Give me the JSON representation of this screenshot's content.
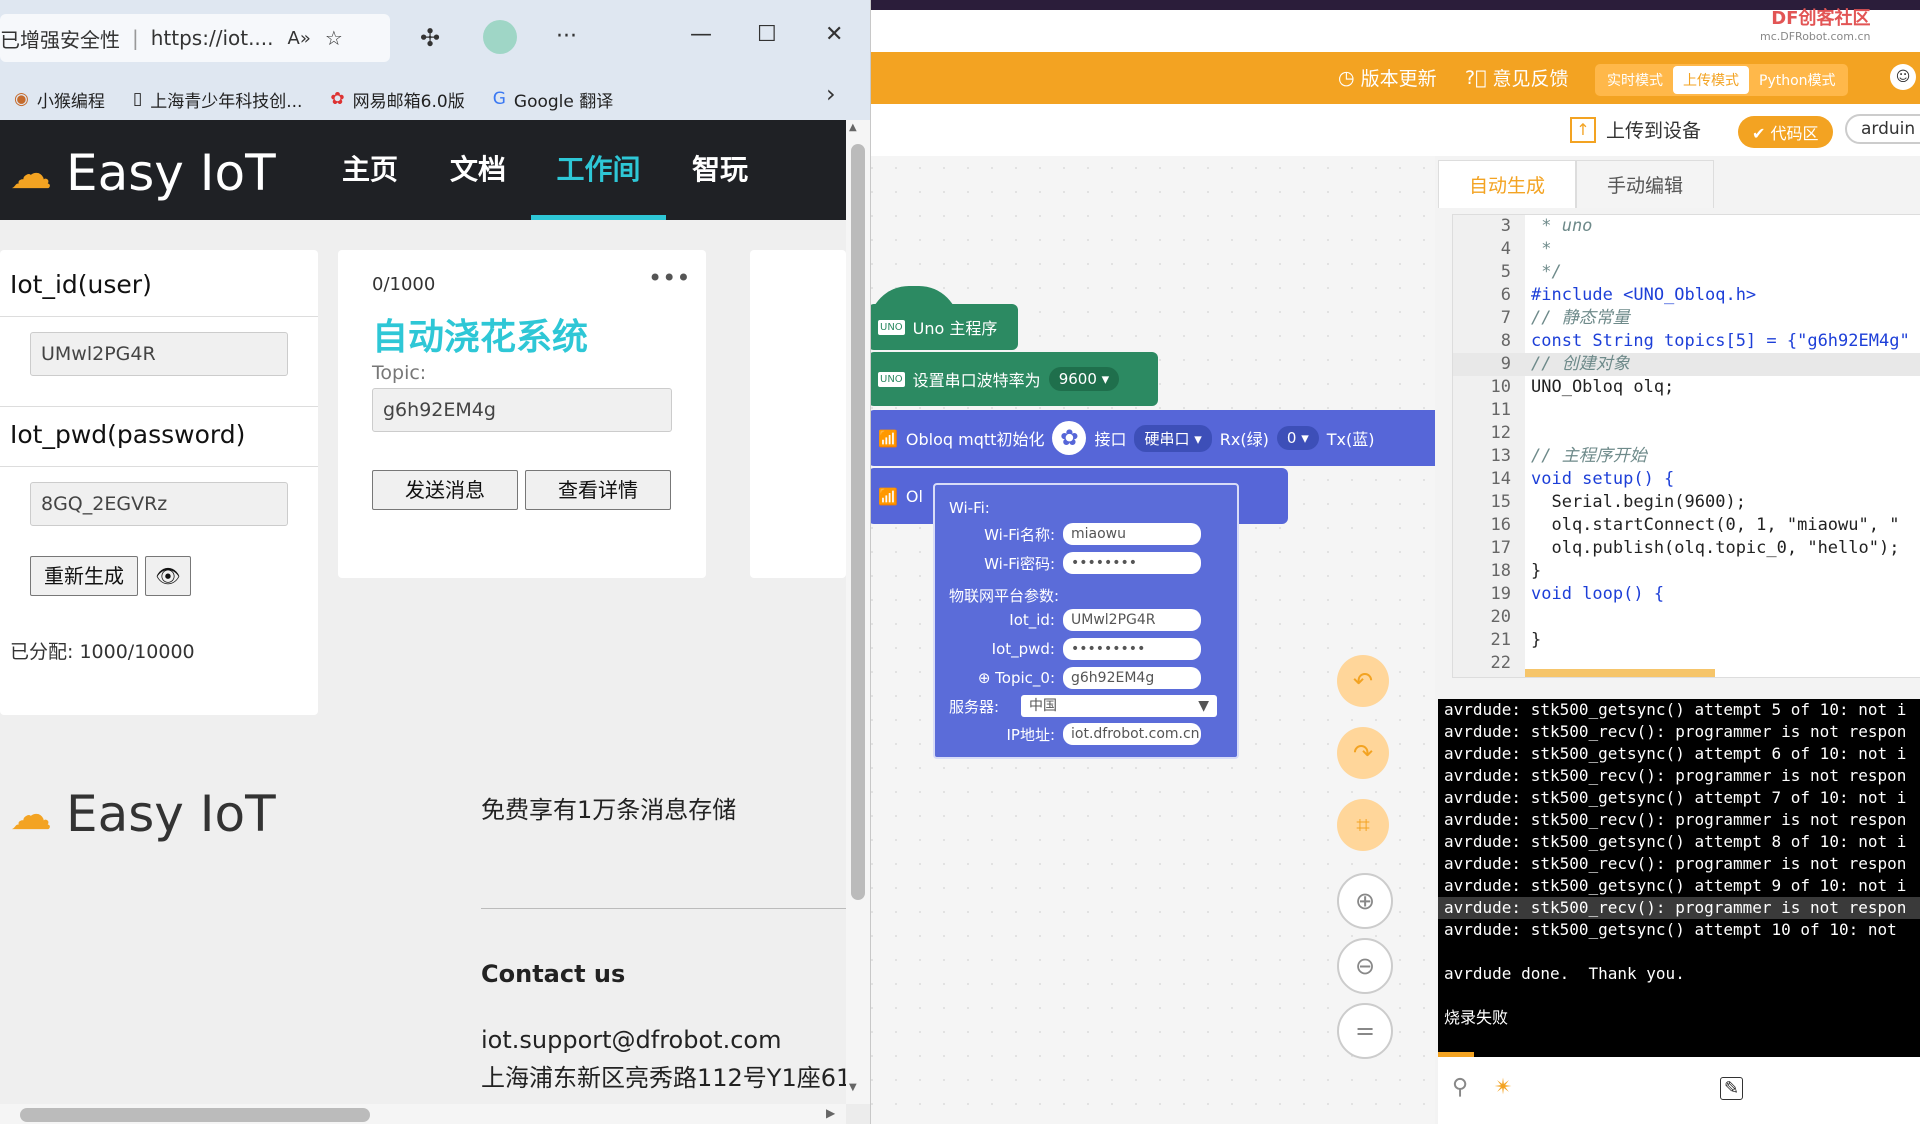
{
  "ide": {
    "watermark": {
      "brand": "DF创客社区",
      "url": "mc.DFRobot.com.cn"
    },
    "header": {
      "version_update": "版本更新",
      "feedback": "意见反馈",
      "modes": [
        "实时模式",
        "上传模式",
        "Python模式"
      ],
      "active_mode": "上传模式"
    },
    "toolbar": {
      "upload": "上传到设备",
      "code_area": "代码区",
      "lang": "arduin"
    },
    "blocks": {
      "main": "Uno 主程序",
      "serial_label": "设置串口波特率为",
      "baud": "9600",
      "mqtt_init": "Obloq mqtt初始化",
      "port_label": "接口",
      "port_value": "硬串口",
      "rx_label": "Rx(绿)",
      "rx_value": "0",
      "tx_label": "Tx(蓝)",
      "second_prefix": "Ol"
    },
    "popup": {
      "wifi_header": "Wi-Fi:",
      "wifi_name_label": "Wi-Fi名称:",
      "wifi_name": "miaowu",
      "wifi_pwd_label": "Wi-Fi密码:",
      "wifi_pwd": "••••••••",
      "iot_header": "物联网平台参数:",
      "iot_id_label": "Iot_id:",
      "iot_id": "UMwl2PG4R",
      "iot_pwd_label": "Iot_pwd:",
      "iot_pwd": "•••••••••",
      "topic_label": "Topic_0:",
      "topic": "g6h92EM4g",
      "server_label": "服务器:",
      "server": "中国",
      "ip_label": "IP地址:",
      "ip": "iot.dfrobot.com.cn"
    },
    "tabs": {
      "auto": "自动生成",
      "manual": "手动编辑"
    },
    "code_lines": [
      {
        "n": "3",
        "t": " * uno"
      },
      {
        "n": "4",
        "t": " *"
      },
      {
        "n": "5",
        "t": " */"
      },
      {
        "n": "6",
        "t": "#include <UNO_Obloq.h>"
      },
      {
        "n": "7",
        "t": "// 静态常量"
      },
      {
        "n": "8",
        "t": "const String topics[5] = {\"g6h92EM4g\""
      },
      {
        "n": "9",
        "t": "// 创建对象"
      },
      {
        "n": "10",
        "t": "UNO_Obloq olq;"
      },
      {
        "n": "11",
        "t": ""
      },
      {
        "n": "12",
        "t": ""
      },
      {
        "n": "13",
        "t": "// 主程序开始"
      },
      {
        "n": "14",
        "t": "void setup() {"
      },
      {
        "n": "15",
        "t": "  Serial.begin(9600);"
      },
      {
        "n": "16",
        "t": "  olq.startConnect(0, 1, \"miaowu\", \""
      },
      {
        "n": "17",
        "t": "  olq.publish(olq.topic_0, \"hello\");"
      },
      {
        "n": "18",
        "t": "}"
      },
      {
        "n": "19",
        "t": "void loop() {"
      },
      {
        "n": "20",
        "t": ""
      },
      {
        "n": "21",
        "t": "}"
      },
      {
        "n": "22",
        "t": ""
      }
    ],
    "console_lines": [
      "avrdude: stk500_getsync() attempt 5 of 10: not i",
      "avrdude: stk500_recv(): programmer is not respon",
      "avrdude: stk500_getsync() attempt 6 of 10: not i",
      "avrdude: stk500_recv(): programmer is not respon",
      "avrdude: stk500_getsync() attempt 7 of 10: not i",
      "avrdude: stk500_recv(): programmer is not respon",
      "avrdude: stk500_getsync() attempt 8 of 10: not i",
      "avrdude: stk500_recv(): programmer is not respon",
      "avrdude: stk500_getsync() attempt 9 of 10: not i",
      "avrdude: stk500_recv(): programmer is not respon",
      "avrdude: stk500_getsync() attempt 10 of 10: not",
      "",
      "avrdude done.  Thank you.",
      "",
      "烧录失败"
    ]
  },
  "browser": {
    "security": "已增强安全性",
    "url": "https://iot....",
    "favorites": [
      "小猴编程",
      "上海青少年科技创...",
      "网易邮箱6.0版",
      "Google 翻译"
    ],
    "site": {
      "logo": "Easy IoT",
      "nav": [
        "主页",
        "文档",
        "工作间",
        "智玩"
      ],
      "nav_active": "工作间"
    },
    "credentials": {
      "iot_id_label": "Iot_id(user)",
      "iot_id": "UMwl2PG4R",
      "iot_pwd_label": "Iot_pwd(password)",
      "iot_pwd": "8GQ_2EGVRz",
      "regen": "重新生成",
      "allocated": "已分配:  1000/10000"
    },
    "device_card": {
      "count": "0/1000",
      "title": "自动浇花系统",
      "topic_label": "Topic:",
      "topic": "g6h92EM4g",
      "send": "发送消息",
      "detail": "查看详情"
    },
    "footer": {
      "logo": "Easy IoT",
      "slogan": "免费享有1万条消息存储",
      "contact_title": "Contact us",
      "email": "iot.support@dfrobot.com",
      "address": "上海浦东新区亮秀路112号Y1座61"
    }
  }
}
